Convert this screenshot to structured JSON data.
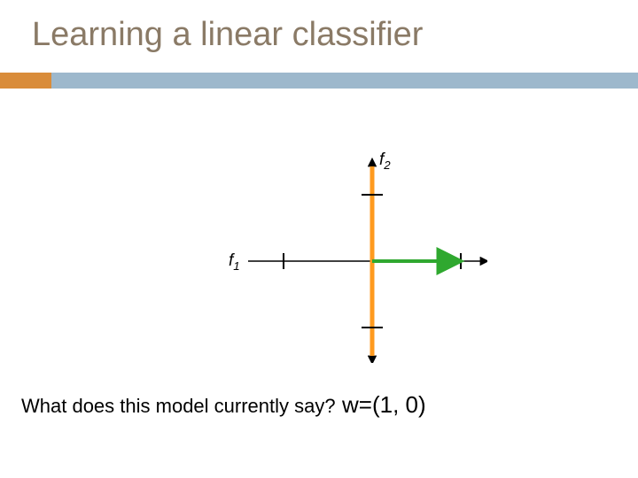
{
  "title": "Learning a linear classifier",
  "axes": {
    "x_label_html": "f<sub>1</sub>",
    "y_label_html": "f<sub>2</sub>"
  },
  "question": "What does this model currently say?",
  "weight_vector": "w=(1, 0)",
  "chart_data": {
    "type": "diagram",
    "description": "2D coordinate axes with vertical orange line (decision boundary on f2-axis) and green weight vector pointing along positive f1 direction",
    "weight_vector": [
      1,
      0
    ],
    "boundary": "vertical line at f1=0",
    "axis_range": {
      "f1": [
        -1.5,
        1.5
      ],
      "f2": [
        -1.3,
        1.3
      ]
    },
    "ticks": {
      "f1": [
        -1,
        1
      ],
      "f2": [
        -1,
        1
      ]
    }
  },
  "colors": {
    "title": "#8a7a66",
    "accent_orange": "#d98c3a",
    "accent_blue": "#9db8cc",
    "boundary": "#ff9a1f",
    "vector": "#2fa82f"
  }
}
